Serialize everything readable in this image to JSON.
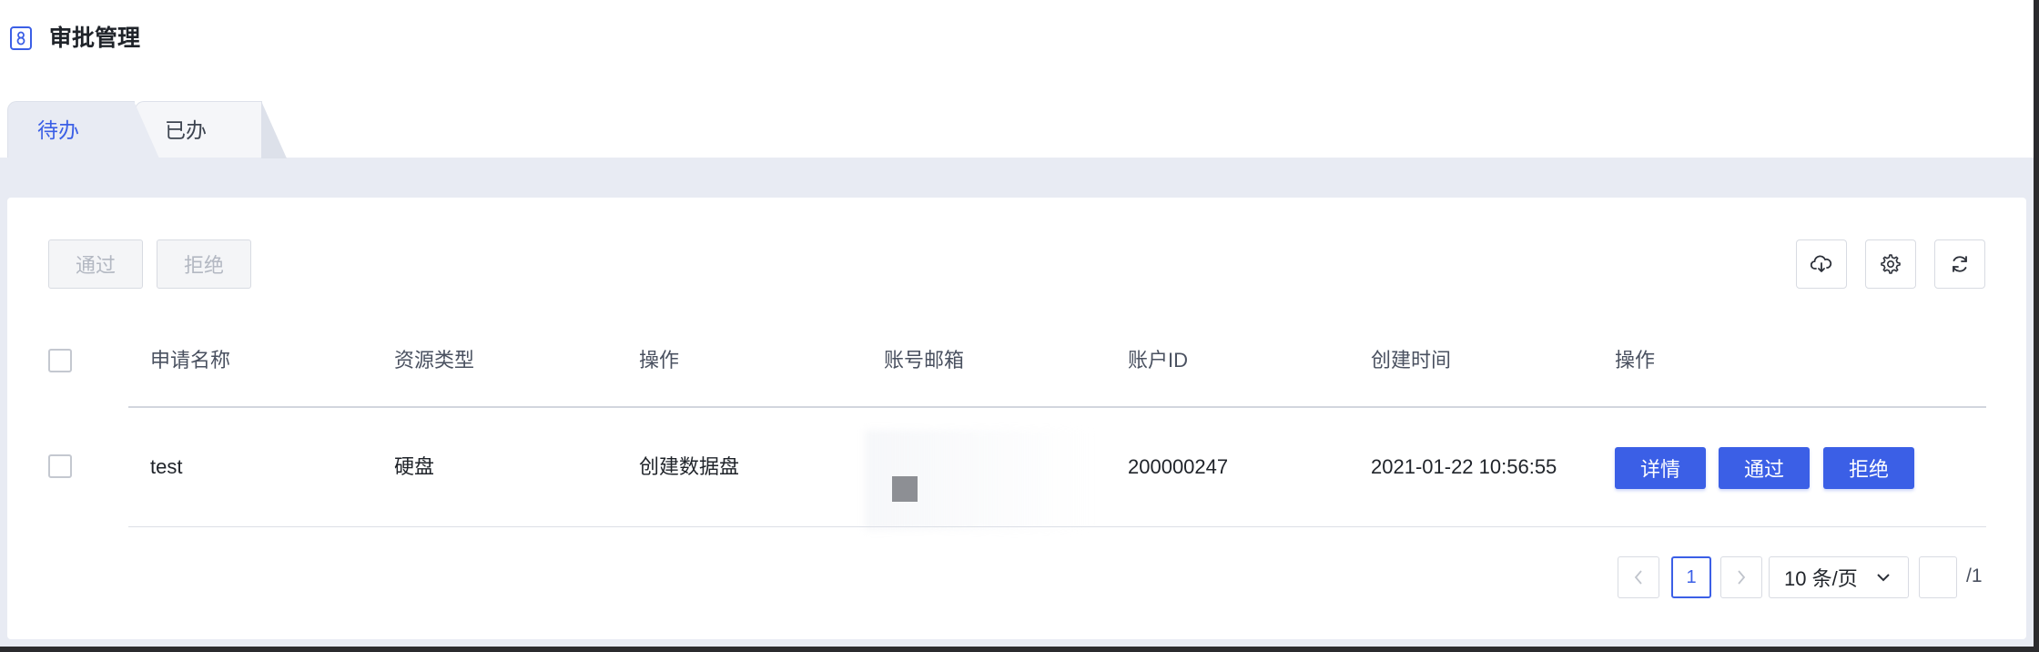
{
  "header": {
    "title": "审批管理",
    "logo_icon": "approval-app-icon"
  },
  "tabs": [
    {
      "label": "待办",
      "active": true
    },
    {
      "label": "已办",
      "active": false
    }
  ],
  "toolbar": {
    "approve_label": "通过",
    "reject_label": "拒绝",
    "icons": [
      "cloud-download-icon",
      "gear-icon",
      "refresh-icon"
    ]
  },
  "table": {
    "columns": [
      "申请名称",
      "资源类型",
      "操作",
      "账号邮箱",
      "账户ID",
      "创建时间",
      "操作"
    ],
    "rows": [
      {
        "name": "test",
        "resource_type": "硬盘",
        "operation": "创建数据盘",
        "email": "",
        "account_id": "200000247",
        "created_at": "2021-01-22 10:56:55",
        "actions": [
          "详情",
          "通过",
          "拒绝"
        ]
      }
    ]
  },
  "pagination": {
    "current_page": "1",
    "page_size": "10 条/页",
    "jump_value": "",
    "total_pages": "/1"
  },
  "colors": {
    "primary": "#3b5fe6",
    "page_bg": "#e8ebf3",
    "disabled_text": "#b3b8c2"
  }
}
